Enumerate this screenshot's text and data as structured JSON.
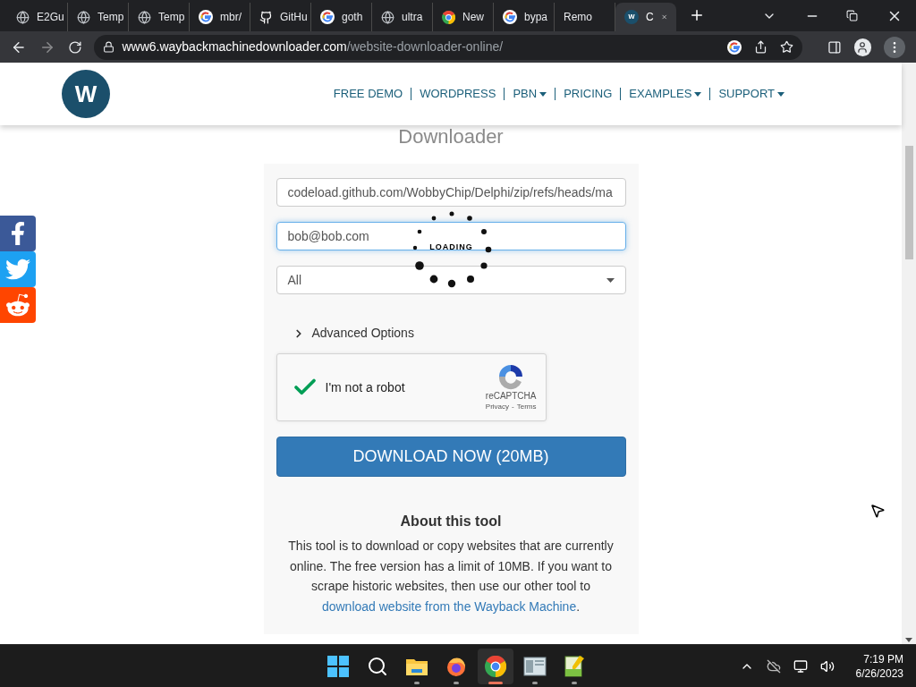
{
  "browser": {
    "tabs": [
      {
        "title": "E2Gu",
        "kind": "globe",
        "selected": false
      },
      {
        "title": "Temp",
        "kind": "globe",
        "selected": false
      },
      {
        "title": "Temp",
        "kind": "globe",
        "selected": false
      },
      {
        "title": "mbr/",
        "kind": "google",
        "selected": false
      },
      {
        "title": "GitHu",
        "kind": "github",
        "selected": false
      },
      {
        "title": "goth",
        "kind": "google",
        "selected": false
      },
      {
        "title": "ultra",
        "kind": "globe",
        "selected": false
      },
      {
        "title": "New",
        "kind": "chrome",
        "selected": false
      },
      {
        "title": "bypa",
        "kind": "google",
        "selected": false
      },
      {
        "title": "Remo",
        "kind": "blank",
        "selected": false
      },
      {
        "title": "C",
        "kind": "site",
        "favicon_letter": "w",
        "selected": true
      }
    ],
    "address": {
      "host": "www6.waybackmachinedownloader.com",
      "path": "/website-downloader-online/"
    }
  },
  "header": {
    "logo_letter": "W",
    "nav": [
      {
        "label": "FREE DEMO",
        "dropdown": false
      },
      {
        "label": "WORDPRESS",
        "dropdown": false
      },
      {
        "label": "PBN",
        "dropdown": true
      },
      {
        "label": "PRICING",
        "dropdown": false
      },
      {
        "label": "EXAMPLES",
        "dropdown": true
      },
      {
        "label": "SUPPORT",
        "dropdown": true
      }
    ]
  },
  "page_heading": "Downloader",
  "social": [
    {
      "kind": "facebook"
    },
    {
      "kind": "twitter"
    },
    {
      "kind": "reddit"
    }
  ],
  "form": {
    "url_value": "codeload.github.com/WobbyChip/Delphi/zip/refs/heads/ma",
    "email_value": "bob@bob.com",
    "email_focused": true,
    "select_value": "All",
    "advanced_label": "Advanced Options",
    "advanced_expanded": false,
    "captcha": {
      "label": "I'm not a robot",
      "checked": true,
      "brand": "reCAPTCHA",
      "privacy": "Privacy",
      "separator": "-",
      "terms": "Terms"
    },
    "button": "DOWNLOAD NOW (20MB)"
  },
  "loading": {
    "label": "LOADING"
  },
  "about": {
    "title": "About this tool",
    "text": "This tool is to download or copy websites that are currently online. The free version has a limit of 10MB. If you want to scrape historic websites, then use our other tool to",
    "link": "download website from the Wayback Machine",
    "after": "."
  },
  "taskbar": {
    "apps": [
      {
        "kind": "start",
        "selected": false
      },
      {
        "kind": "search",
        "selected": false
      },
      {
        "kind": "explorer",
        "selected": false
      },
      {
        "kind": "firefox",
        "selected": false
      },
      {
        "kind": "chrome",
        "selected": true
      },
      {
        "kind": "window",
        "selected": false
      },
      {
        "kind": "editor",
        "selected": false
      }
    ],
    "time": "7:19 PM",
    "date": "6/26/2023"
  }
}
